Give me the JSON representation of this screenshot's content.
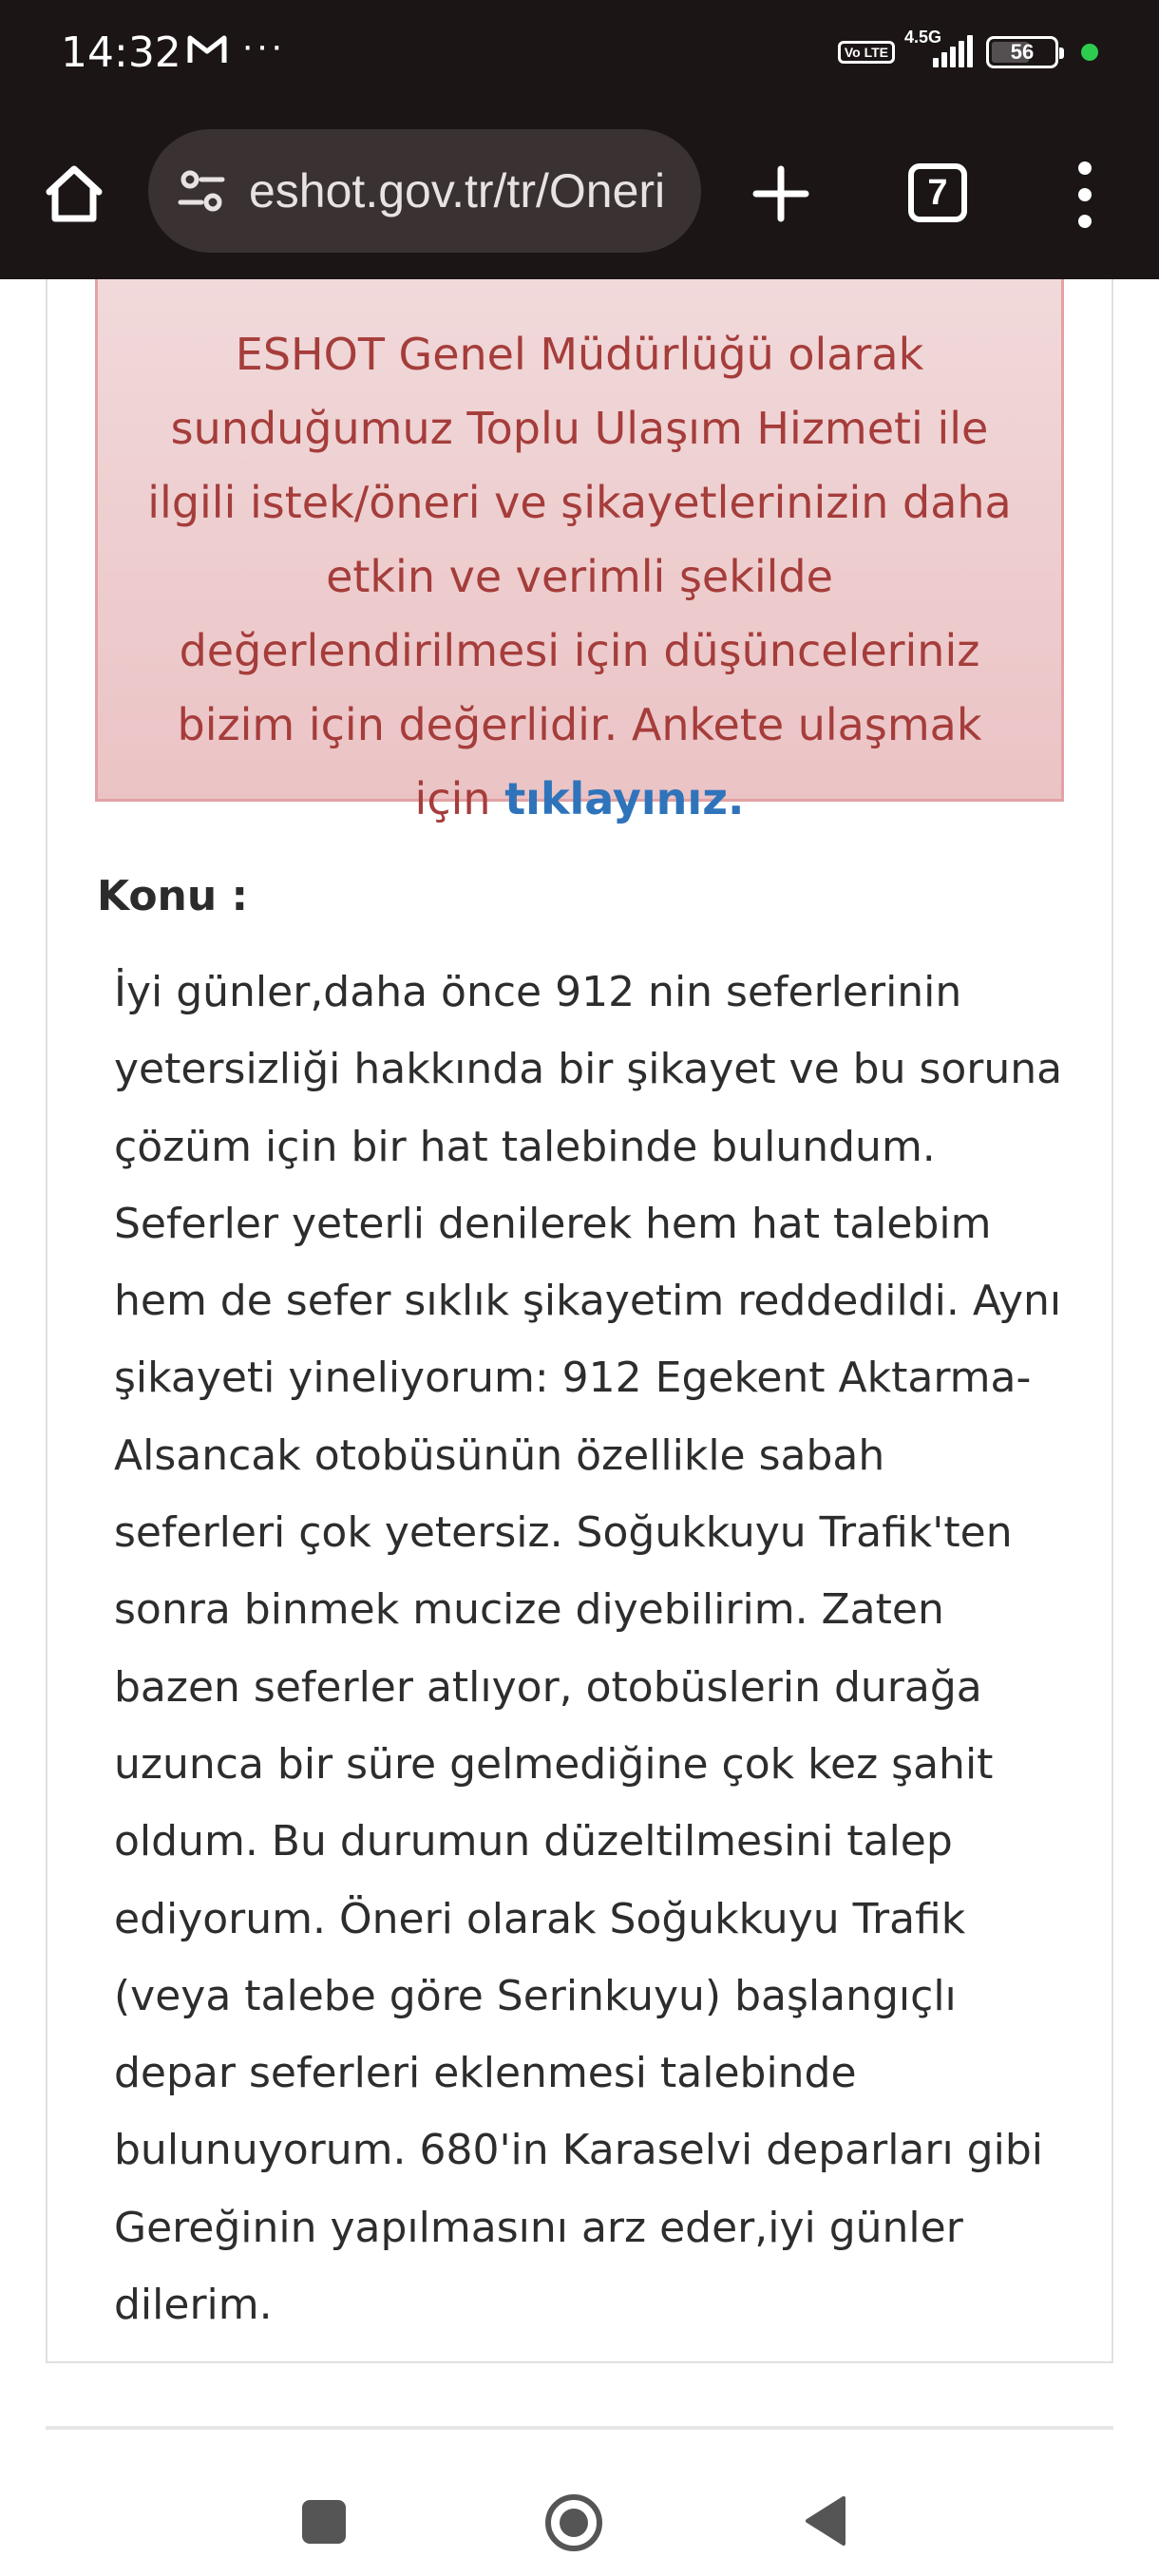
{
  "status_bar": {
    "time": "14:32",
    "dots": "···",
    "volte": "Vo LTE",
    "network": "4.5G",
    "battery": "56"
  },
  "browser": {
    "url": "eshot.gov.tr/tr/Oneri",
    "tab_count": "7"
  },
  "notice": {
    "text": "ESHOT Genel Müdürlüğü olarak sunduğumuz Toplu Ulaşım Hizmeti ile ilgili istek/öneri ve şikayetlerinizin daha etkin ve verimli şekilde değerlendirilmesi için düşünceleriniz bizim için değerlidir. Ankete ulaşmak için ",
    "link": "tıklayınız."
  },
  "konu": {
    "label": "Konu :",
    "text": "İyi günler,daha önce 912 nin seferlerinin yetersizliği hakkında bir şikayet ve bu soruna çözüm için bir hat talebinde bulundum. Seferler yeterli denilerek hem hat talebim hem de sefer sıklık şikayetim reddedildi. Aynı şikayeti yineliyorum: 912 Egekent Aktarma-Alsancak otobüsünün özellikle sabah seferleri çok yetersiz. Soğukkuyu Trafik'ten sonra binmek mucize diyebilirim. Zaten bazen seferler atlıyor, otobüslerin durağa uzunca bir süre gelmediğine çok kez şahit oldum. Bu durumun düzeltilmesini talep ediyorum. Öneri olarak Soğukkuyu Trafik (veya talebe göre Serinkuyu) başlangıçlı depar seferleri eklenmesi talebinde bulunuyorum. 680'in Karaselvi deparları gibi Gereğinin yapılmasını arz eder,iyi günler dilerim."
  },
  "colors": {
    "status_bg": "#1b1516",
    "url_pill_bg": "#3a3133",
    "notice_bg": "#efcfd1",
    "notice_text": "#a53d3b",
    "notice_link": "#2f74bb"
  }
}
